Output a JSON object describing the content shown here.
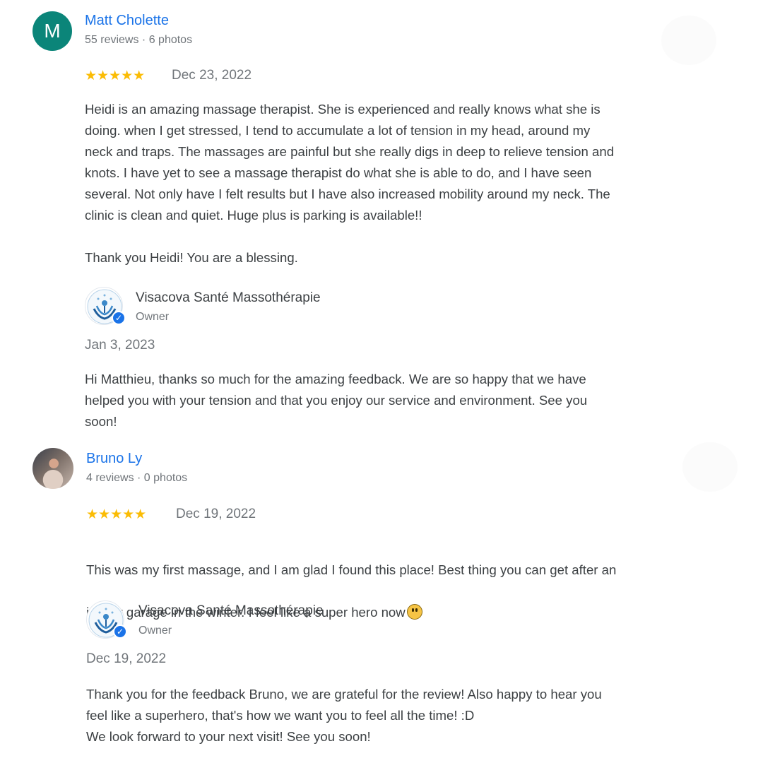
{
  "reviews": [
    {
      "avatar_letter": "M",
      "author": "Matt Cholette",
      "meta": "55 reviews · 6 photos",
      "stars": "★★★★★",
      "rating": 5,
      "date": "Dec 23, 2022",
      "text": "Heidi is an amazing massage therapist. She is experienced and really knows what she is\ndoing. when I get stressed, I tend to accumulate a lot of tension in my head, around my\nneck and traps. The massages are painful but she really digs in deep to relieve tension and\nknots. I have yet to see a massage therapist do what she is able to do, and I have seen\nseveral. Not only have I felt results but I have also increased mobility around my neck. The\nclinic is clean and quiet. Huge plus is parking is available!!\n\nThank you Heidi! You are a blessing.",
      "owner_response": {
        "owner_name": "Visacova Santé Massothérapie",
        "owner_role": "Owner",
        "date": "Jan 3, 2023",
        "text": "Hi Matthieu, thanks so much for the amazing feedback. We are so happy that we have\nhelped you with your tension and that you enjoy our service and environment. See you\nsoon!"
      }
    },
    {
      "author": "Bruno Ly",
      "meta": "4 reviews · 0 photos",
      "stars": "★★★★★",
      "rating": 5,
      "date": "Dec 19, 2022",
      "text_line1": "This was my first massage, and I am glad I found this place! Best thing you can get after an",
      "text_line2": "indoor garage in the winter. I feel like a super hero now",
      "owner_response": {
        "owner_name": "Visacova Santé Massothérapie",
        "owner_role": "Owner",
        "date": "Dec 19, 2022",
        "text": "Thank you for the feedback Bruno, we are grateful for the review! Also happy to hear you\nfeel like a superhero, that's how we want you to feel all the time! :D\nWe look forward to your next visit! See you soon!"
      }
    }
  ],
  "colors": {
    "link": "#1a73e8",
    "star": "#fbbc04",
    "avatar_bg": "#0b8579",
    "muted": "#70757a",
    "text": "#3c4043"
  },
  "icons": [
    "star-icon",
    "verified-badge-icon",
    "business-logo-icon",
    "smiley-emoji-icon"
  ]
}
